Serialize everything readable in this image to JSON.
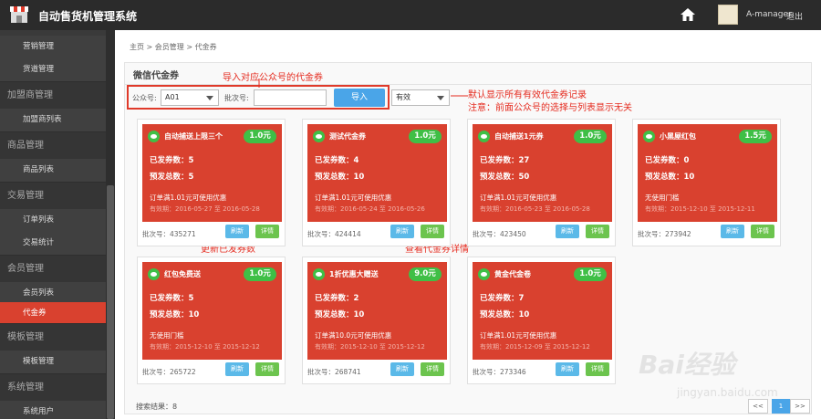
{
  "app": {
    "title": "自动售货机管理系统",
    "user": "A-manager",
    "logout": "退出"
  },
  "sidebar": [
    {
      "label": "营销管理",
      "type": "sub"
    },
    {
      "label": "货道管理",
      "type": "sub"
    },
    {
      "label": "加盟商管理",
      "type": "section"
    },
    {
      "label": "加盟商列表",
      "type": "sub"
    },
    {
      "label": "商品管理",
      "type": "section"
    },
    {
      "label": "商品列表",
      "type": "sub"
    },
    {
      "label": "交易管理",
      "type": "section"
    },
    {
      "label": "订单列表",
      "type": "sub"
    },
    {
      "label": "交易统计",
      "type": "sub"
    },
    {
      "label": "会员管理",
      "type": "section"
    },
    {
      "label": "会员列表",
      "type": "sub"
    },
    {
      "label": "代金券",
      "type": "sub",
      "active": true
    },
    {
      "label": "模板管理",
      "type": "section"
    },
    {
      "label": "模板管理",
      "type": "sub"
    },
    {
      "label": "系统管理",
      "type": "section"
    },
    {
      "label": "系统用户",
      "type": "sub"
    }
  ],
  "breadcrumb": "主页 > 会员管理 > 代金券",
  "panel_title": "微信代金券",
  "filter": {
    "account_label": "公众号:",
    "account_value": "A01",
    "batch_label": "批次号:",
    "batch_value": "",
    "import_label": "导入",
    "status_value": "有效"
  },
  "annotations": {
    "import": "导入对应公众号的代金券",
    "default_line1": "默认显示所有有效代金券记录",
    "default_line2": "注意：前面公众号的选择与列表显示无关",
    "refresh": "更新已发券数",
    "detail": "查看代金券详情"
  },
  "labels": {
    "issued": "已发券数：",
    "pre": "预发总数：",
    "batch": "批次号：",
    "refresh": "刷新",
    "detail": "详情",
    "valid": "有效期："
  },
  "cards": [
    {
      "name": "自动捕送上限三个",
      "amount": "1.0元",
      "issued": "5",
      "pre": "5",
      "condition": "订单满1.01元可使用优惠",
      "valid": "2016-05-27 至 2016-05-28",
      "batch": "435271"
    },
    {
      "name": "测试代金券",
      "amount": "1.0元",
      "issued": "4",
      "pre": "10",
      "condition": "订单满1.01元可使用优惠",
      "valid": "2016-05-24 至 2016-05-26",
      "batch": "424414"
    },
    {
      "name": "自动捕送1元券",
      "amount": "1.0元",
      "issued": "27",
      "pre": "50",
      "condition": "订单满1.01元可使用优惠",
      "valid": "2016-05-23 至 2016-05-28",
      "batch": "423450"
    },
    {
      "name": "小黑屋红包",
      "amount": "1.5元",
      "issued": "0",
      "pre": "10",
      "condition": "无使用门槛",
      "valid": "2015-12-10 至 2015-12-11",
      "batch": "273942"
    },
    {
      "name": "红包免费送",
      "amount": "1.0元",
      "issued": "5",
      "pre": "10",
      "condition": "无使用门槛",
      "valid": "2015-12-10 至 2015-12-12",
      "batch": "265722"
    },
    {
      "name": "1折优惠大赠送",
      "amount": "9.0元",
      "issued": "2",
      "pre": "10",
      "condition": "订单满10.0元可使用优惠",
      "valid": "2015-12-10 至 2015-12-12",
      "batch": "268741"
    },
    {
      "name": "黄金代金卷",
      "amount": "1.0元",
      "issued": "7",
      "pre": "10",
      "condition": "订单满1.01元可使用优惠",
      "valid": "2015-12-09 至 2015-12-12",
      "batch": "273346"
    }
  ],
  "result": "搜索结果：8",
  "pagination": {
    "prev": "<<",
    "current": "1",
    "next": ">>"
  },
  "watermark": {
    "main": "Bai经验",
    "sub": "jingyan.baidu.com"
  }
}
